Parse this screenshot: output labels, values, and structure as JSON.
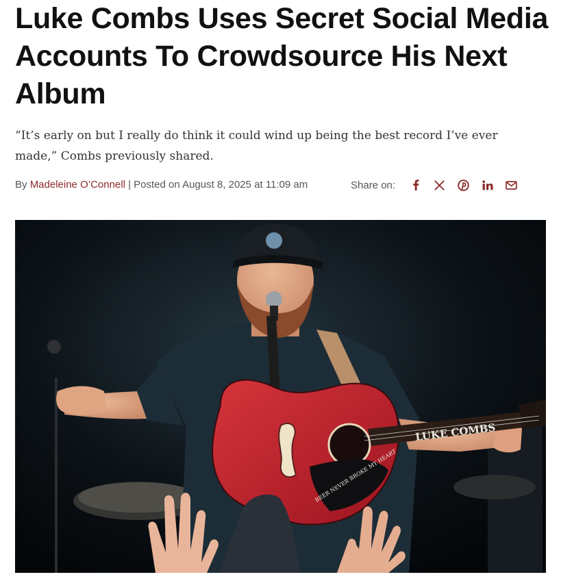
{
  "article": {
    "headline": "Luke Combs Uses Secret Social Media Accounts To Crowdsource His Next Album",
    "dek": "“It’s early on but I really do think it could wind up being the best record I’ve ever made,” Combs previously shared.",
    "byline": {
      "prefix": "By ",
      "author": "Madeleine O’Connell",
      "separator": " | ",
      "posted": "Posted on August 8, 2025 at 11:09 am"
    },
    "share": {
      "label": "Share on:",
      "buttons": [
        {
          "name": "facebook",
          "icon": "facebook-icon"
        },
        {
          "name": "x",
          "icon": "x-icon"
        },
        {
          "name": "pinterest",
          "icon": "pinterest-icon"
        },
        {
          "name": "linkedin",
          "icon": "linkedin-icon"
        },
        {
          "name": "email",
          "icon": "email-icon"
        }
      ]
    },
    "photo": {
      "guitar_text": "LUKE COMBS",
      "pickguard_text": "BEER NEVER BROKE MY HEART"
    }
  },
  "colors": {
    "accent": "#8c2a2a",
    "guitar": "#c3202a",
    "background": "#ffffff"
  }
}
